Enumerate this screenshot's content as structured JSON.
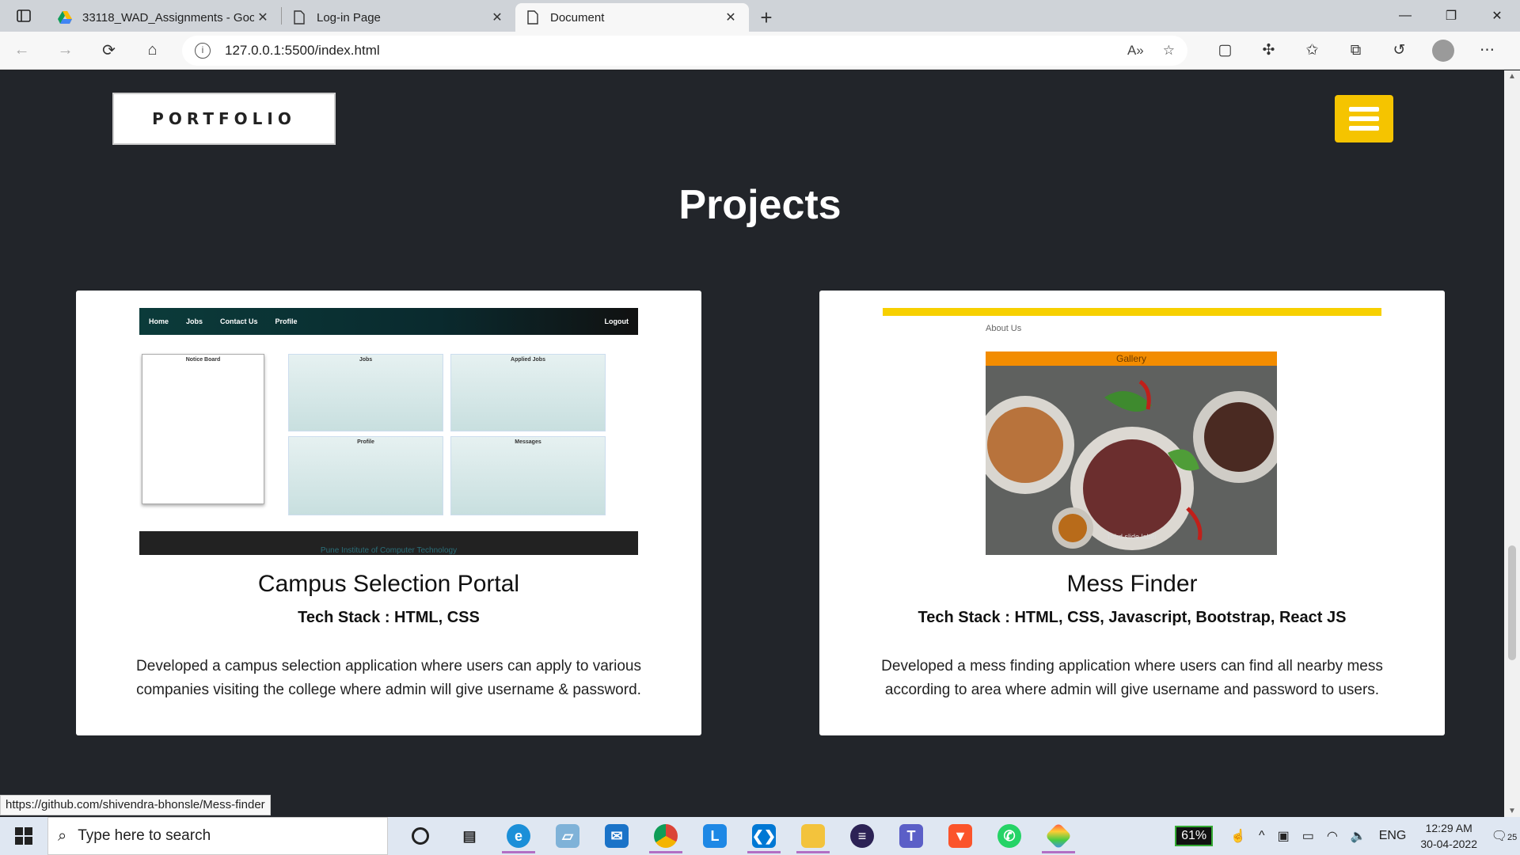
{
  "browser": {
    "tabs": [
      {
        "title": "33118_WAD_Assignments - Goo",
        "icon": "google-drive-icon"
      },
      {
        "title": "Log-in Page",
        "icon": "page-icon"
      },
      {
        "title": "Document",
        "icon": "page-icon"
      }
    ],
    "url": "127.0.0.1:5500/index.html",
    "status_url": "https://github.com/shivendra-bhonsle/Mess-finder"
  },
  "page": {
    "logo": "PORTFOLIO",
    "section_title": "Projects",
    "accent_color": "#f5c400",
    "projects": [
      {
        "title": "Campus Selection Portal",
        "tech": "Tech Stack : HTML, CSS",
        "description": "Developed a campus selection application where users can apply to various companies visiting the college where admin will give username & password.",
        "preview": {
          "nav": [
            "Home",
            "Jobs",
            "Contact Us",
            "Profile"
          ],
          "logout": "Logout",
          "notice_title": "Notice Board",
          "panels": [
            "Jobs",
            "Applied Jobs",
            "Profile",
            "Messages"
          ],
          "footer": "Pune Institute of Computer Technology"
        }
      },
      {
        "title": "Mess Finder",
        "tech": "Tech Stack : HTML, CSS, Javascript, Bootstrap, React JS",
        "description": "Developed a mess finding application where users can find all nearby mess according to area where admin will give username and password to users.",
        "preview": {
          "about": "About Us",
          "gallery": "Gallery",
          "caption": "Third slide label"
        }
      }
    ]
  },
  "taskbar": {
    "search_placeholder": "Type here to search",
    "battery": "61%",
    "language": "ENG",
    "time": "12:29 AM",
    "date": "30-04-2022",
    "notifications": "25"
  }
}
